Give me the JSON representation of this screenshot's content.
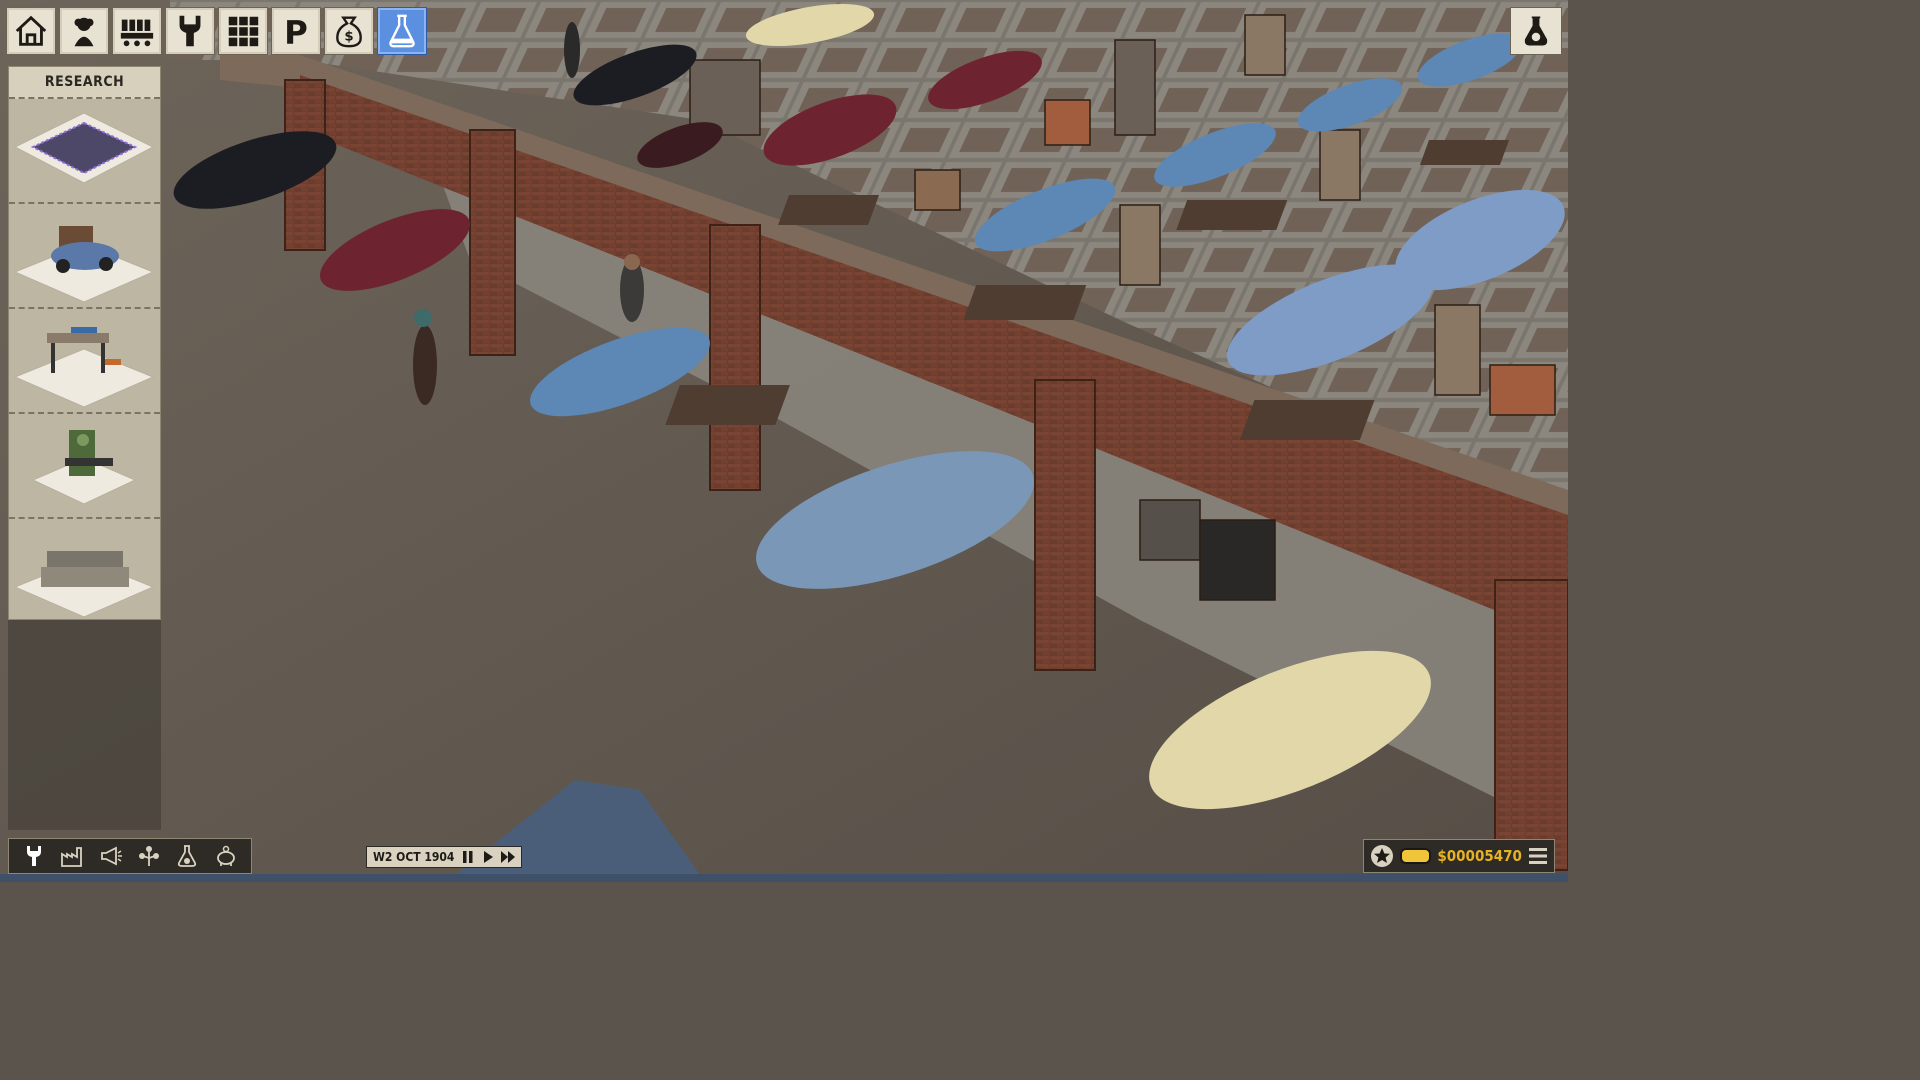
{
  "top_toolbar": {
    "buttons": [
      {
        "name": "home",
        "icon": "house-icon",
        "active": false
      },
      {
        "name": "workers",
        "icon": "worker-icon",
        "active": false
      },
      {
        "name": "production",
        "icon": "assembly-line-icon",
        "active": false
      },
      {
        "name": "tools",
        "icon": "wrench-icon",
        "active": false
      },
      {
        "name": "layout",
        "icon": "grid-icon",
        "active": false
      },
      {
        "name": "parking",
        "icon": "parking-icon",
        "label": "P",
        "active": false
      },
      {
        "name": "finance",
        "icon": "money-bag-icon",
        "active": false
      },
      {
        "name": "research",
        "icon": "flask-icon",
        "active": true
      }
    ],
    "corner_button": {
      "icon": "research-flask-icon"
    }
  },
  "research_panel": {
    "title": "RESEARCH",
    "items": [
      {
        "name": "floor-tile",
        "icon": "floor-tile-icon"
      },
      {
        "name": "vintage-car",
        "icon": "car-icon"
      },
      {
        "name": "workbench",
        "icon": "workbench-icon"
      },
      {
        "name": "machine",
        "icon": "press-machine-icon"
      },
      {
        "name": "sofa",
        "icon": "sofa-icon"
      }
    ]
  },
  "bottom_toolbar": {
    "icons": [
      "wrench-icon",
      "factory-icon",
      "megaphone-icon",
      "tree-icon",
      "flask-icon",
      "piggy-bank-icon"
    ]
  },
  "time_control": {
    "date": "W2 OCT 1904",
    "controls": [
      "pause-icon",
      "play-icon",
      "fast-forward-icon"
    ]
  },
  "money": {
    "value": "$00005470"
  },
  "colors": {
    "toolbar_bg": "#e8e2d2",
    "active_blue": "#5b8fe0",
    "money_yellow": "#e7b224",
    "panel_bg": "#bdb6a2"
  }
}
